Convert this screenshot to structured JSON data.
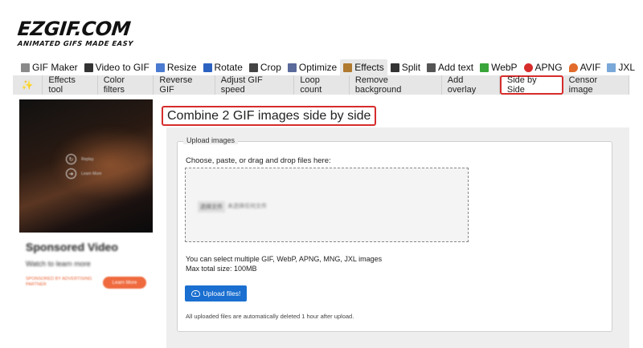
{
  "logo": {
    "title": "EZGIF.COM",
    "tagline": "ANIMATED GIFS MADE EASY"
  },
  "main_nav": [
    {
      "label": "GIF Maker",
      "icon": "gif-maker-icon",
      "color": "#8a8a8a"
    },
    {
      "label": "Video to GIF",
      "icon": "video-icon",
      "color": "#333333"
    },
    {
      "label": "Resize",
      "icon": "resize-icon",
      "color": "#4a7bd0"
    },
    {
      "label": "Rotate",
      "icon": "rotate-icon",
      "color": "#2b62c0"
    },
    {
      "label": "Crop",
      "icon": "crop-icon",
      "color": "#444444"
    },
    {
      "label": "Optimize",
      "icon": "optimize-icon",
      "color": "#5a6a9a"
    },
    {
      "label": "Effects",
      "icon": "effects-icon",
      "color": "#b07a30",
      "active": true
    },
    {
      "label": "Split",
      "icon": "split-icon",
      "color": "#333333"
    },
    {
      "label": "Add text",
      "icon": "add-text-icon",
      "color": "#555555"
    },
    {
      "label": "WebP",
      "icon": "webp-icon",
      "color": "#3aa53a"
    },
    {
      "label": "APNG",
      "icon": "apng-icon",
      "color": "#d62c2c"
    },
    {
      "label": "AVIF",
      "icon": "avif-icon",
      "color": "#e26b2b"
    },
    {
      "label": "JXL",
      "icon": "jxl-icon",
      "color": "#7aa8d8"
    }
  ],
  "sub_nav": [
    {
      "label": "Effects tool"
    },
    {
      "label": "Color filters"
    },
    {
      "label": "Reverse GIF"
    },
    {
      "label": "Adjust GIF speed"
    },
    {
      "label": "Loop count"
    },
    {
      "label": "Remove background"
    },
    {
      "label": "Add overlay"
    },
    {
      "label": "Side by Side",
      "active": true
    },
    {
      "label": "Censor image"
    }
  ],
  "ad": {
    "replay": "Replay",
    "learn_more_overlay": "Learn More",
    "title": "Sponsored Video",
    "subtitle": "Watch to learn more",
    "sponsor": "SPONSORED BY ADVERTISING PARTNER",
    "cta": "Learn More"
  },
  "page_title": "Combine 2 GIF images side by side",
  "upload": {
    "legend": "Upload images",
    "choose_label": "Choose, paste, or drag and drop files here:",
    "file_button": "选择文件",
    "file_status": "未选择任何文件",
    "info_formats": "You can select multiple GIF, WebP, APNG, MNG, JXL images",
    "info_size": "Max total size: 100MB",
    "button": "Upload files!",
    "auto_delete": "All uploaded files are automatically deleted 1 hour after upload."
  },
  "colors": {
    "highlight": "#d62c2c",
    "primary_button": "#1a6fd0",
    "ad_cta": "#ef6a3e"
  }
}
